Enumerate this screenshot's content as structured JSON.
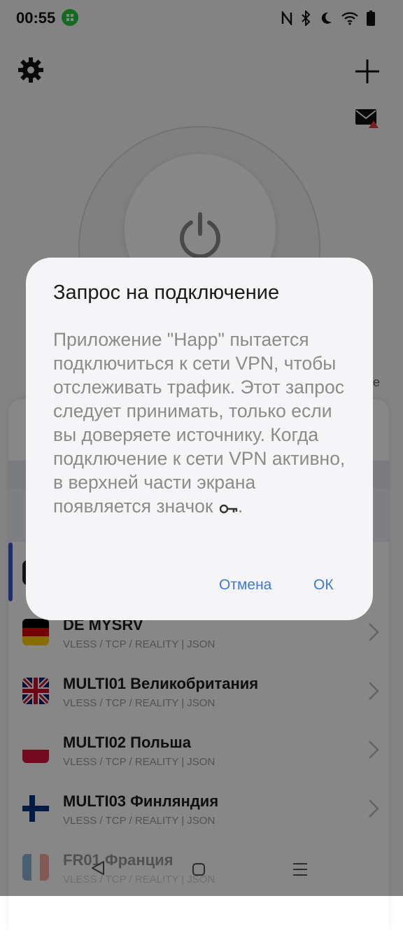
{
  "status_bar": {
    "time": "00:55",
    "icons": [
      "app-notification-icon",
      "nfc-icon",
      "bluetooth-icon",
      "dnd-moon-icon",
      "wifi-icon",
      "battery-icon"
    ]
  },
  "header": {
    "settings_icon": "gear-icon",
    "add_icon": "plus-icon",
    "mail_icon": "mail-alert-icon"
  },
  "side_letter": "e",
  "servers": [
    {
      "name": "DE MYSRV",
      "protocol": "VLESS / TCP / REALITY | JSON",
      "flag": "germany"
    },
    {
      "name": "MULTI01 Великобритания",
      "protocol": "VLESS / TCP / REALITY | JSON",
      "flag": "uk"
    },
    {
      "name": "MULTI02 Польша",
      "protocol": "VLESS / TCP / REALITY | JSON",
      "flag": "poland"
    },
    {
      "name": "MULTI03 Финляндия",
      "protocol": "VLESS / TCP / REALITY | JSON",
      "flag": "finland"
    },
    {
      "name": "FR01 Франция",
      "protocol": "VLESS / TCP / REALITY | JSON",
      "flag": "france"
    }
  ],
  "dialog": {
    "title": "Запрос на подключение",
    "message": "Приложение \"Happ\" пытается подключиться к сети VPN, чтобы отслеживать трафик. Этот запрос следует принимать, только если вы доверяете источнику. Когда подключение к сети VPN активно, в верхней части экрана появляется значок",
    "message_end": ".",
    "cancel_label": "Отмена",
    "ok_label": "ОК"
  },
  "colors": {
    "accent": "#3c7ad6",
    "selected_bar": "#3a57c8",
    "notif_green": "#27c93f"
  }
}
